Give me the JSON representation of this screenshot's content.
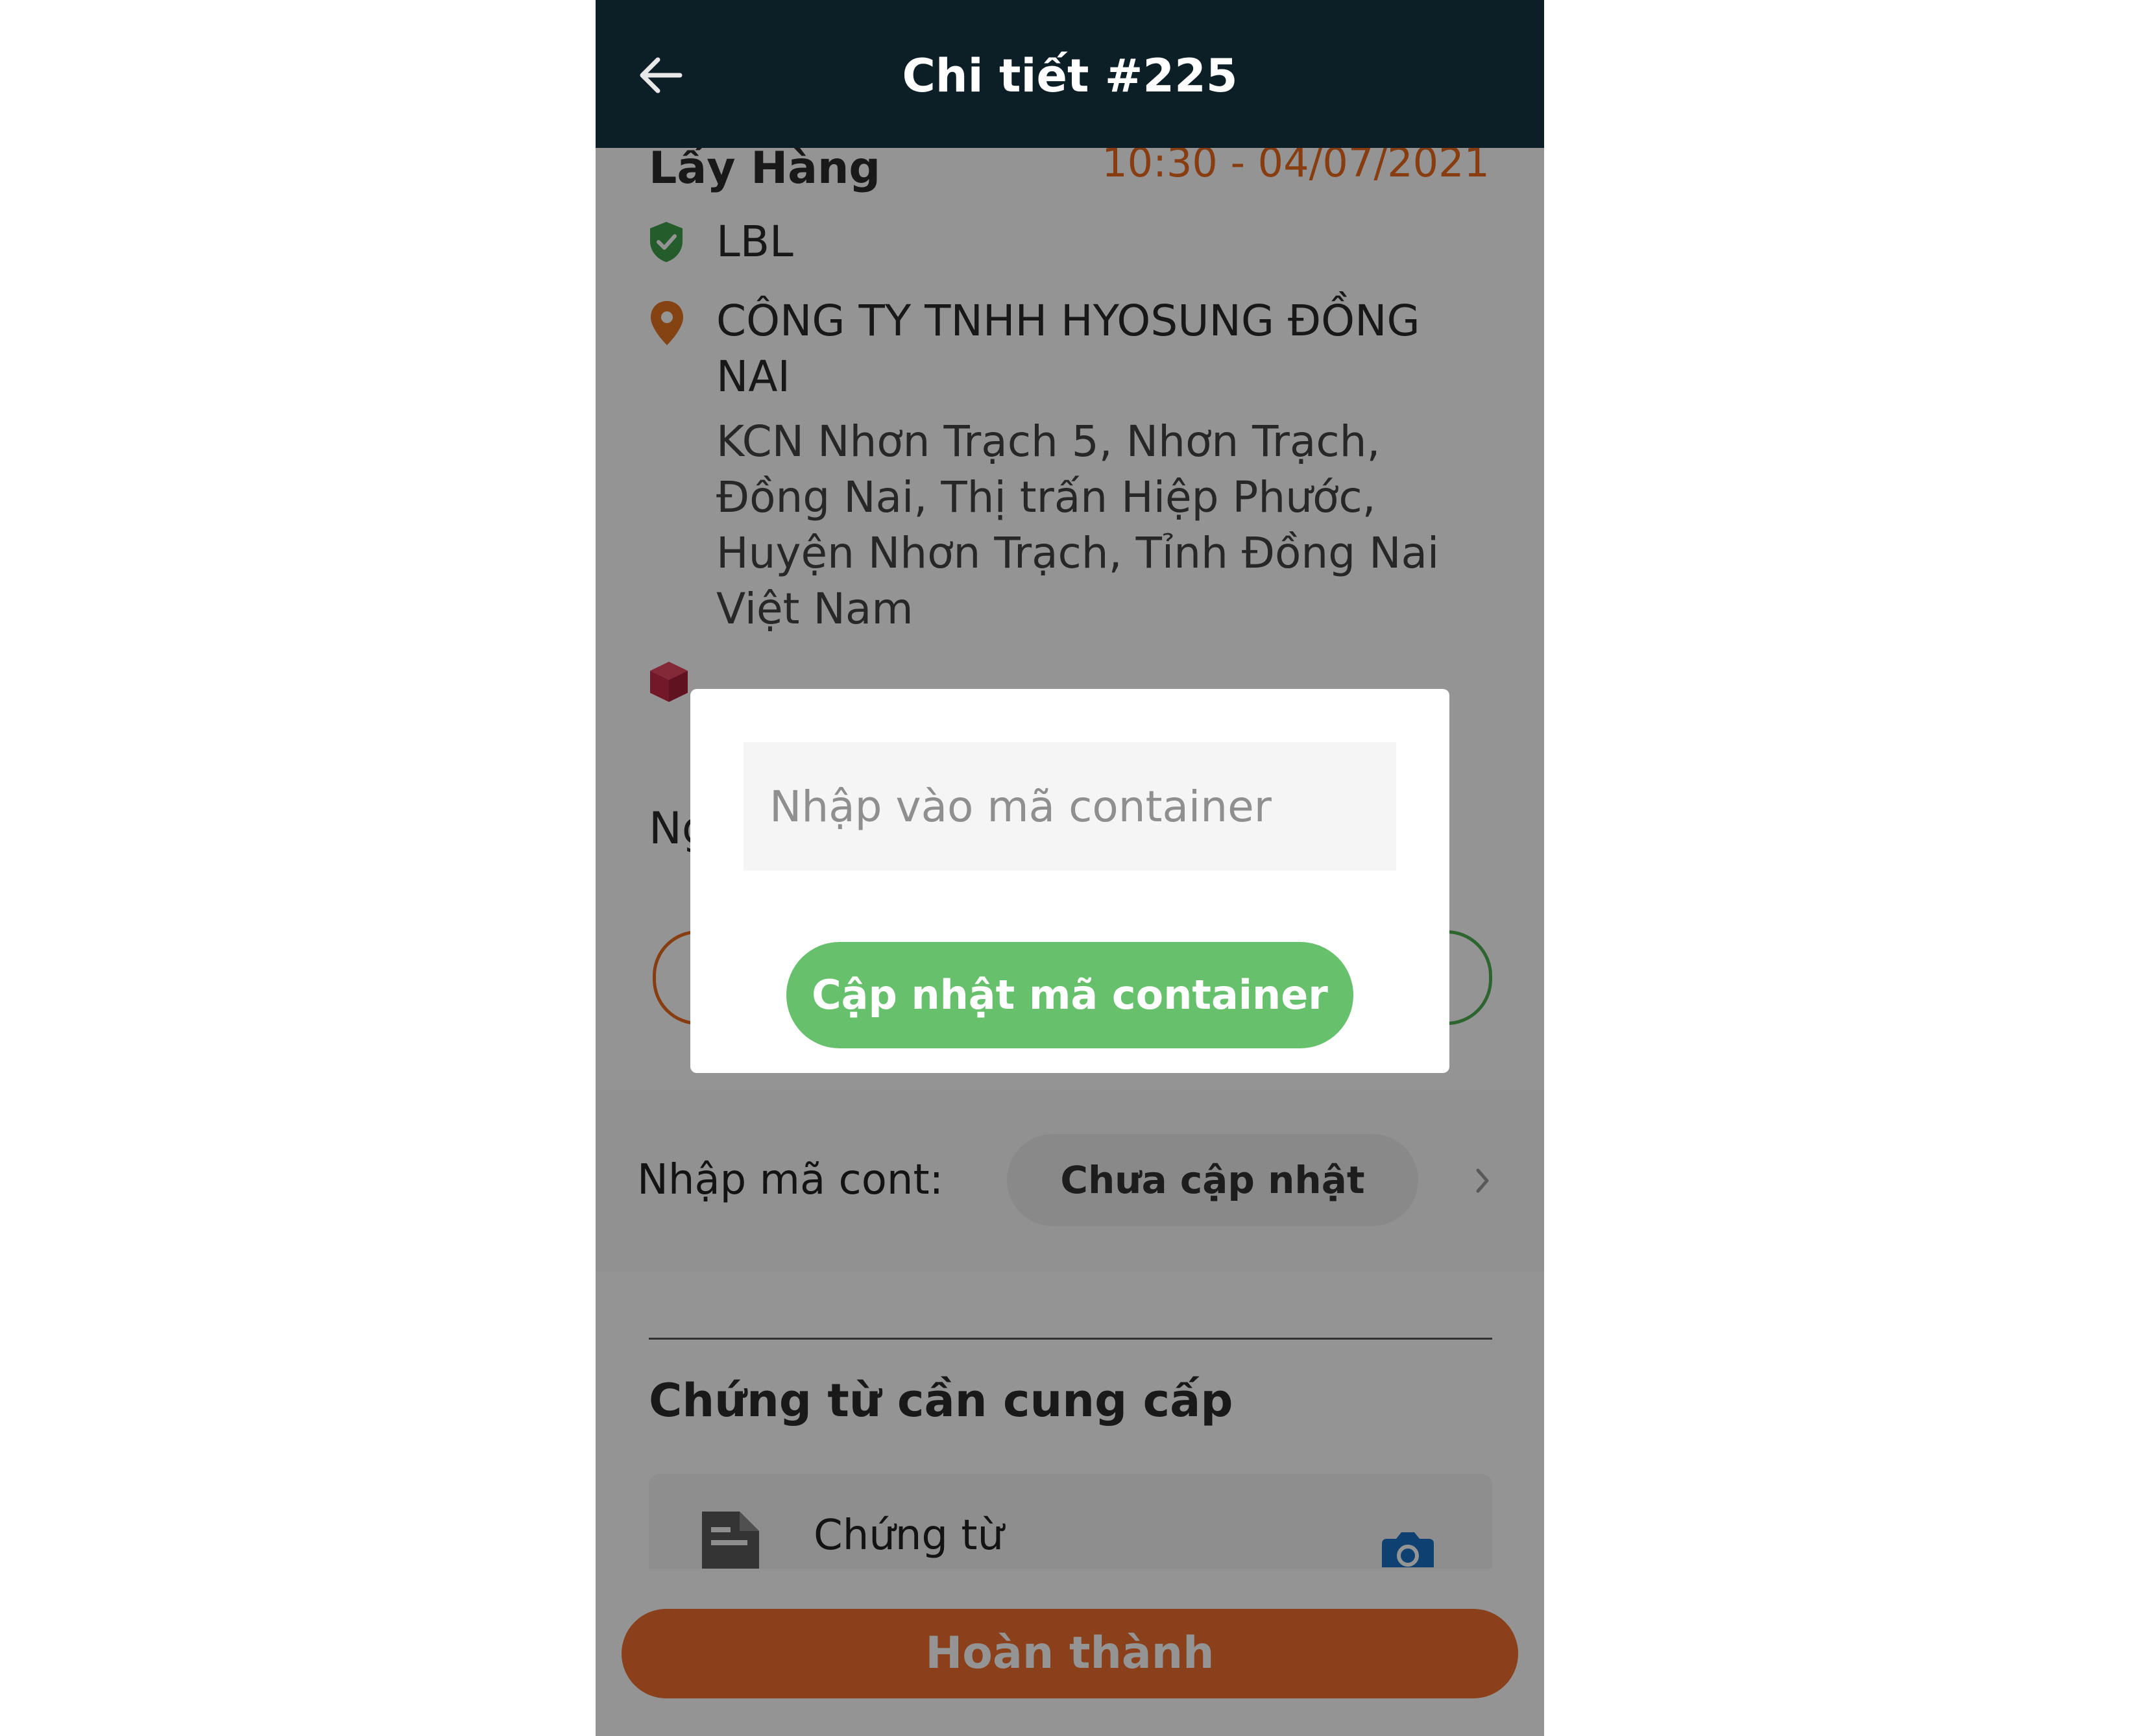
{
  "header": {
    "title": "Chi tiết #225",
    "back_icon": "arrow-left-icon"
  },
  "pickup": {
    "section_title": "Lấy Hàng",
    "datetime": "10:30 - 04/07/2021",
    "carrier": "LBL",
    "company": "CÔNG TY TNHH HYOSUNG ĐỒNG NAI",
    "address": "KCN Nhơn Trạch 5, Nhơn Trạch, Đồng Nai, Thị trấn Hiệp Phước, Huyện Nhơn Trạch, Tỉnh Đồng Nai Việt Nam",
    "partial_label": "Ng"
  },
  "container_code": {
    "label": "Nhập mã cont:",
    "status": "Chưa cập nhật"
  },
  "documents": {
    "title": "Chứng từ cần cung cấp",
    "item_label": "Chứng từ"
  },
  "footer": {
    "finish_label": "Hoàn thành"
  },
  "modal": {
    "input_placeholder": "Nhập vào mã container",
    "input_value": "",
    "update_label": "Cập nhật mã container"
  },
  "colors": {
    "header_bg": "#0c1e26",
    "accent_orange": "#ea6a1e",
    "accent_green": "#67c06c",
    "camera_blue": "#1a6fc4"
  }
}
